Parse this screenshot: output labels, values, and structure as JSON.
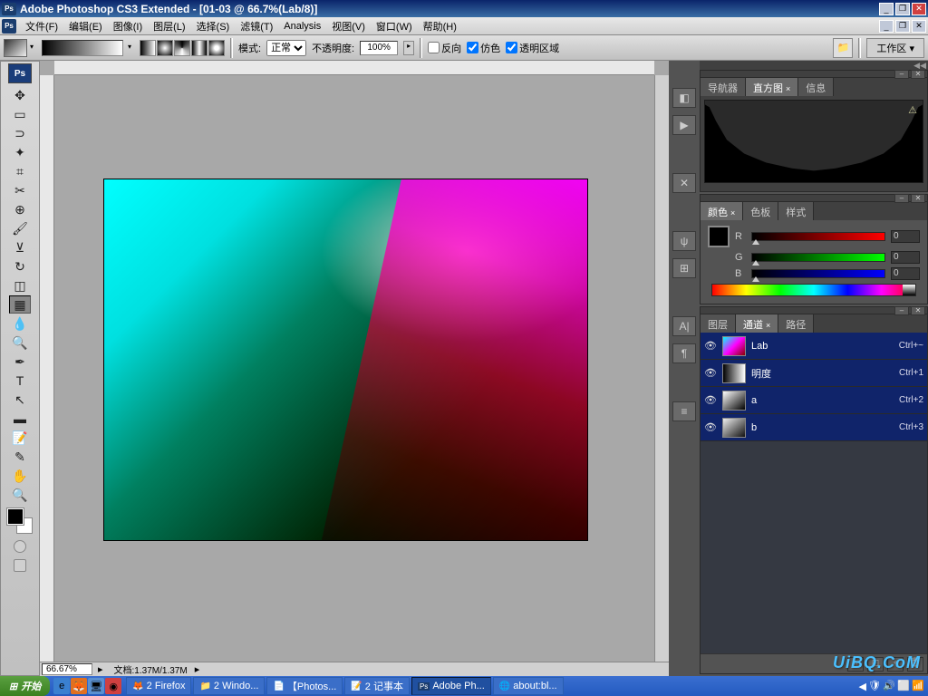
{
  "title": "Adobe Photoshop CS3 Extended - [01-03 @ 66.7%(Lab/8)]",
  "menu": [
    "文件(F)",
    "编辑(E)",
    "图像(I)",
    "图层(L)",
    "选择(S)",
    "滤镜(T)",
    "Analysis",
    "视图(V)",
    "窗口(W)",
    "帮助(H)"
  ],
  "opt": {
    "mode_lbl": "模式:",
    "mode_val": "正常",
    "opacity_lbl": "不透明度:",
    "opacity_val": "100%",
    "reverse": "反向",
    "dither": "仿色",
    "transp": "透明区域",
    "workspace": "工作区 ▾"
  },
  "zoom": "66.67%",
  "docinfo": "文档:1.37M/1.37M",
  "panels": {
    "nav_tabs": [
      "导航器",
      "直方图",
      "信息"
    ],
    "color_tabs": [
      "颜色",
      "色板",
      "样式"
    ],
    "rgb": {
      "r": "0",
      "g": "0",
      "b": "0"
    },
    "chan_tabs": [
      "图层",
      "通道",
      "路径"
    ],
    "channels": [
      {
        "name": "Lab",
        "key": "Ctrl+~",
        "cls": "lab"
      },
      {
        "name": "明度",
        "key": "Ctrl+1",
        "cls": "l"
      },
      {
        "name": "a",
        "key": "Ctrl+2",
        "cls": "a"
      },
      {
        "name": "b",
        "key": "Ctrl+3",
        "cls": "b"
      }
    ]
  },
  "taskbar": {
    "start": "开始",
    "items": [
      "2 Firefox",
      "2 Windo...",
      "【Photos...",
      "2 记事本",
      "Adobe Ph...",
      "about:bl..."
    ]
  },
  "watermark": "UiBQ.CoM"
}
